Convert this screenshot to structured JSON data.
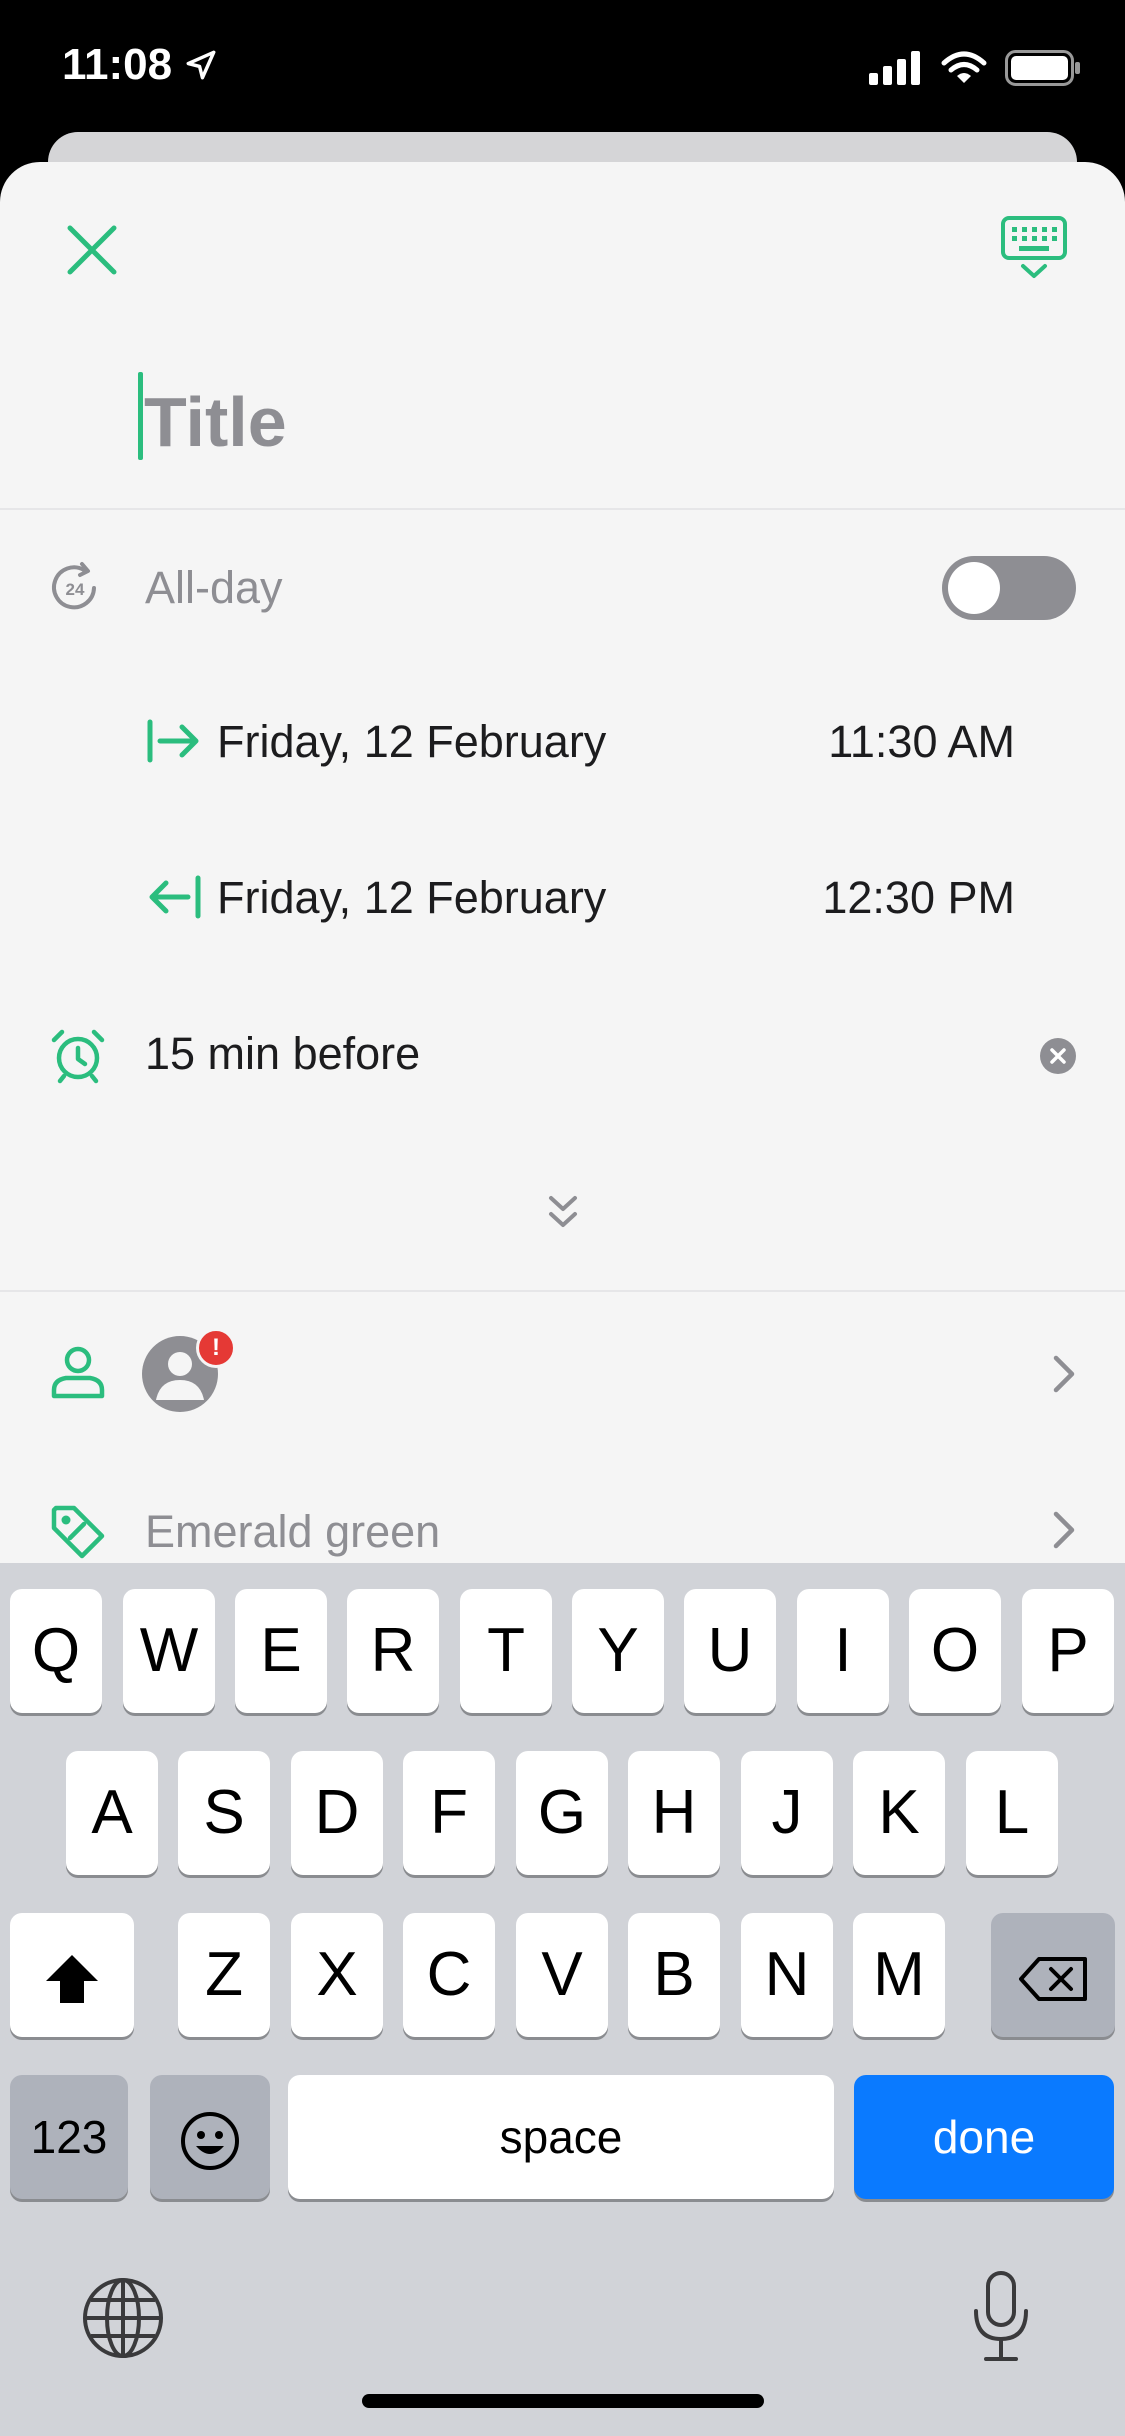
{
  "status_bar": {
    "time": "11:08"
  },
  "title": {
    "placeholder": "Title"
  },
  "all_day": {
    "label": "All-day",
    "enabled": false
  },
  "start": {
    "date": "Friday, 12 February",
    "time": "11:30 AM"
  },
  "end": {
    "date": "Friday, 12 February",
    "time": "12:30 PM"
  },
  "alert": {
    "label": "15 min before"
  },
  "attendee": {
    "badge": "!"
  },
  "color": {
    "label": "Emerald green"
  },
  "keyboard": {
    "row1": [
      "Q",
      "W",
      "E",
      "R",
      "T",
      "Y",
      "U",
      "I",
      "O",
      "P"
    ],
    "row2": [
      "A",
      "S",
      "D",
      "F",
      "G",
      "H",
      "J",
      "K",
      "L"
    ],
    "row3": [
      "Z",
      "X",
      "C",
      "V",
      "B",
      "N",
      "M"
    ],
    "numbers": "123",
    "space": "space",
    "done": "done"
  },
  "colors": {
    "accent": "#2bbd7e",
    "muted": "#8e8e93",
    "keyboard_bg": "#d1d3d8",
    "done_blue": "#0a7aff"
  }
}
